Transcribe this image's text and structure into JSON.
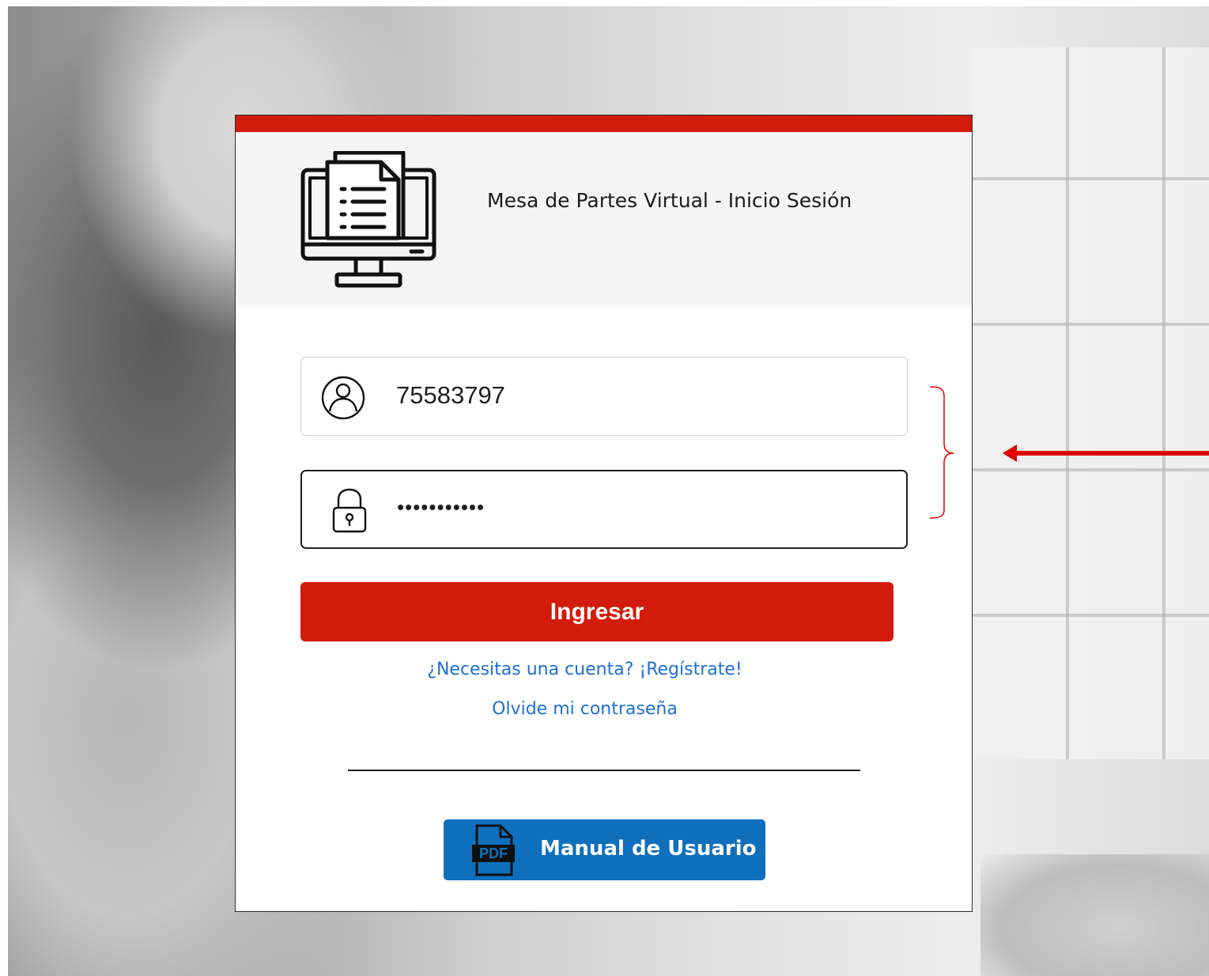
{
  "header": {
    "title": "Mesa de Partes Virtual - Inicio Sesión",
    "icon": "desktop-document-icon"
  },
  "login": {
    "username_value": "75583797",
    "username_icon": "user-icon",
    "password_value": "•••••••••••",
    "password_icon": "lock-icon"
  },
  "actions": {
    "submit_label": "Ingresar",
    "register_link": "¿Necesitas una cuenta? ¡Regístrate!",
    "forgot_link": "Olvide mi contraseña",
    "manual_label": "Manual de Usuario",
    "manual_icon": "pdf-icon",
    "manual_icon_text": "PDF"
  },
  "colors": {
    "accent_red": "#d21b0a",
    "link_blue": "#1e6fd9",
    "manual_blue": "#0e6fbd",
    "header_bg": "#f5f5f5"
  },
  "annotation": {
    "arrow_color": "#e00000"
  }
}
